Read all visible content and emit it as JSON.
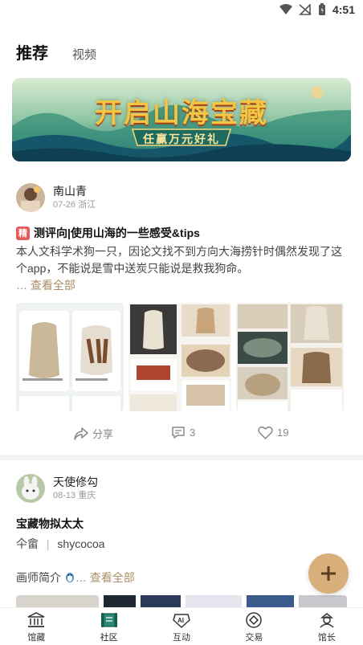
{
  "status_bar": {
    "time": "4:51"
  },
  "tabs": {
    "active": "推荐",
    "inactive": "视频"
  },
  "banner": {
    "title": "开启山海宝藏",
    "subtitle": "任赢万元好礼"
  },
  "posts": [
    {
      "author": "南山青",
      "meta": "07-26 浙江",
      "badge": "精",
      "title": "测评向|使用山海的一些感受&tips",
      "body": "本人文科学术狗一只，因论文找不到方向大海捞针时偶然发现了这个app，不能说是雪中送炭只能说是救我狗命。",
      "ellipsis": "…",
      "see_all": "查看全部",
      "share_label": "分享",
      "comment_count": "3",
      "like_count": "19"
    },
    {
      "author": "天使修勾",
      "meta": "08-13 重庆",
      "title": "宝藏物拟太太",
      "line1_a": "仐畲",
      "line1_b": "shycocoa",
      "intro": "画师简介",
      "ellipsis": "…",
      "see_all": "查看全部"
    }
  ],
  "bottom_nav": [
    {
      "label": "馆藏",
      "icon": "museum-icon"
    },
    {
      "label": "社区",
      "icon": "scroll-icon"
    },
    {
      "label": "互动",
      "icon": "ai-icon"
    },
    {
      "label": "交易",
      "icon": "coin-icon"
    },
    {
      "label": "馆长",
      "icon": "curator-icon"
    }
  ],
  "colors": {
    "accent": "#a98f63",
    "fab": "#d8ae7a",
    "badge": "#e65a5a"
  }
}
